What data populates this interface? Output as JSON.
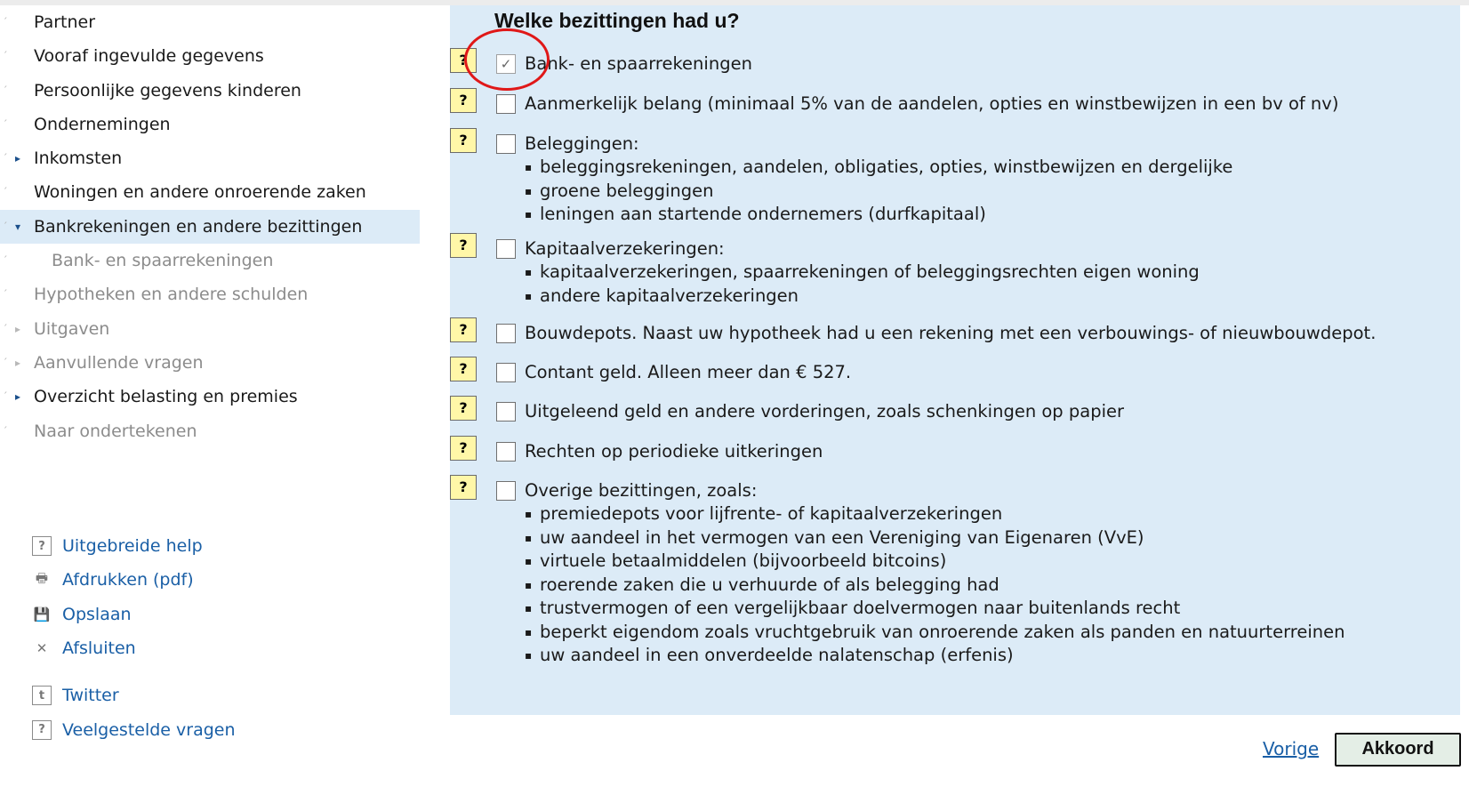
{
  "sidebar": {
    "items": [
      {
        "label": "Partner",
        "arrow": "",
        "state": "normal"
      },
      {
        "label": "Vooraf ingevulde gegevens",
        "arrow": "",
        "state": "normal"
      },
      {
        "label": "Persoonlijke gegevens kinderen",
        "arrow": "",
        "state": "normal"
      },
      {
        "label": "Ondernemingen",
        "arrow": "",
        "state": "normal"
      },
      {
        "label": "Inkomsten",
        "arrow": "▸",
        "state": "normal"
      },
      {
        "label": "Woningen en andere onroerende zaken",
        "arrow": "",
        "state": "normal"
      },
      {
        "label": "Bankrekeningen en andere bezittingen",
        "arrow": "▾",
        "state": "active"
      },
      {
        "label": "Bank- en spaarrekeningen",
        "arrow": "",
        "state": "sub"
      },
      {
        "label": "Hypotheken en andere schulden",
        "arrow": "",
        "state": "disabled"
      },
      {
        "label": "Uitgaven",
        "arrow": "▸",
        "state": "disabled"
      },
      {
        "label": "Aanvullende vragen",
        "arrow": "▸",
        "state": "disabled"
      },
      {
        "label": "Overzicht belasting en premies",
        "arrow": "▸",
        "state": "normal"
      },
      {
        "label": "Naar ondertekenen",
        "arrow": "",
        "state": "disabled"
      }
    ],
    "links": [
      {
        "label": "Uitgebreide help",
        "icon": "help-icon",
        "glyph": "?"
      },
      {
        "label": "Afdrukken (pdf)",
        "icon": "printer-icon",
        "glyph": "🖶"
      },
      {
        "label": "Opslaan",
        "icon": "save-icon",
        "glyph": "💾"
      },
      {
        "label": "Afsluiten",
        "icon": "close-icon",
        "glyph": "✕"
      },
      {
        "label": "Twitter",
        "icon": "twitter-icon",
        "glyph": "t"
      },
      {
        "label": "Veelgestelde vragen",
        "icon": "help-icon",
        "glyph": "?"
      }
    ]
  },
  "main": {
    "title": "Welke bezittingen had u?",
    "help_glyph": "?",
    "questions": [
      {
        "label": "Bank- en spaarrekeningen",
        "checked": true,
        "sub": []
      },
      {
        "label": "Aanmerkelijk belang (minimaal 5% van de aandelen, opties en winstbewijzen in een bv of nv)",
        "checked": false,
        "sub": []
      },
      {
        "label": "Beleggingen:",
        "checked": false,
        "sub": [
          "beleggingsrekeningen, aandelen, obligaties, opties, winstbewijzen en dergelijke",
          "groene beleggingen",
          "leningen aan startende ondernemers (durfkapitaal)"
        ]
      },
      {
        "label": "Kapitaalverzekeringen:",
        "checked": false,
        "sub": [
          "kapitaalverzekeringen, spaarrekeningen of beleggingsrechten eigen woning",
          "andere kapitaalverzekeringen"
        ]
      },
      {
        "label": "Bouwdepots. Naast uw hypotheek had u een rekening met een verbouwings- of nieuwbouwdepot.",
        "checked": false,
        "sub": []
      },
      {
        "label": "Contant geld. Alleen meer dan € 527.",
        "checked": false,
        "sub": []
      },
      {
        "label": "Uitgeleend geld en andere vorderingen, zoals schenkingen op papier",
        "checked": false,
        "sub": []
      },
      {
        "label": "Rechten op periodieke uitkeringen",
        "checked": false,
        "sub": []
      },
      {
        "label": "Overige bezittingen, zoals:",
        "checked": false,
        "sub": [
          "premiedepots voor lijfrente- of kapitaalverzekeringen",
          "uw aandeel in het vermogen van een Vereniging van Eigenaren (VvE)",
          "virtuele betaalmiddelen (bijvoorbeeld bitcoins)",
          "roerende zaken die u verhuurde of als belegging had",
          "trustvermogen of een vergelijkbaar doelvermogen naar buitenlands recht",
          "beperkt eigendom zoals vruchtgebruik van onroerende zaken als panden en natuurterreinen",
          "uw aandeel in een onverdeelde nalatenschap (erfenis)"
        ]
      }
    ]
  },
  "footer": {
    "prev_label": "Vorige",
    "next_label": "Akkoord"
  },
  "colors": {
    "panel_bg": "#dcebf7",
    "link": "#1a5fa6",
    "help_button": "#fff7a8",
    "highlight_circle": "#e01818"
  }
}
